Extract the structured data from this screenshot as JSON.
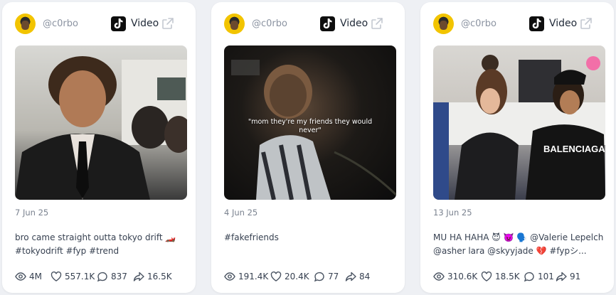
{
  "cards": [
    {
      "handle": "@c0rbo",
      "type_label": "Video",
      "date": "7 Jun 25",
      "caption": "bro came straight outta tokyo drift 🏎️ #tokyodrift #fyp #trend",
      "overlay": "",
      "stats": {
        "views": "4M",
        "likes": "557.1K",
        "comments": "837",
        "shares": "16.5K"
      }
    },
    {
      "handle": "@c0rbo",
      "type_label": "Video",
      "date": "4 Jun 25",
      "caption": "#fakefriends",
      "overlay": "\"mom they're my friends they would never\"",
      "stats": {
        "views": "191.4K",
        "likes": "20.4K",
        "comments": "77",
        "shares": "84"
      }
    },
    {
      "handle": "@c0rbo",
      "type_label": "Video",
      "date": "13 Jun 25",
      "caption": "MU HA HAHA 😈 👿 🗣️ @Valerie Lepelch @asher lara @skyyjade 💔 #fypシ...",
      "overlay": "",
      "stats": {
        "views": "310.6K",
        "likes": "18.5K",
        "comments": "101",
        "shares": "91"
      }
    }
  ],
  "icons": {
    "platform": "tiktok-icon",
    "external": "external-link-icon",
    "views": "eye-icon",
    "likes": "heart-icon",
    "comments": "comment-icon",
    "shares": "share-icon"
  },
  "colors": {
    "background": "#eef0f4",
    "card": "#ffffff",
    "muted": "#8b93a1",
    "text": "#374151"
  }
}
